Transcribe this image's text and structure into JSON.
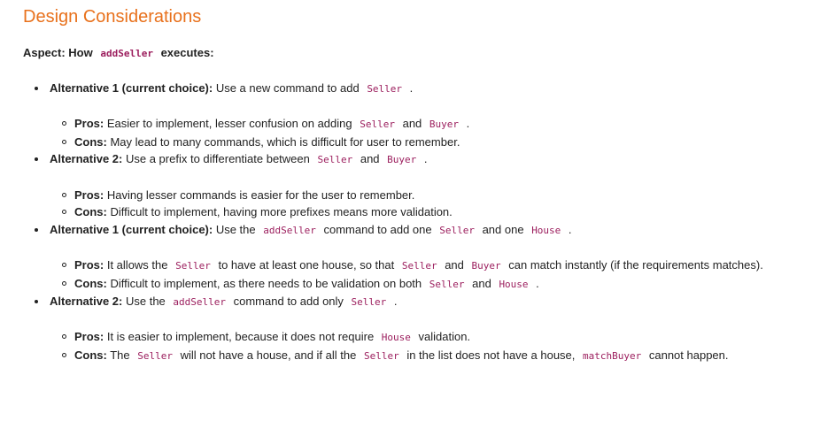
{
  "colors": {
    "heading": "#e8711c",
    "code": "#9c1f5e",
    "text": "#222222"
  },
  "title": "Design Considerations",
  "aspect": [
    {
      "b": "Aspect: How "
    },
    {
      "c": "addSeller"
    },
    {
      "b": " executes:"
    }
  ],
  "items": [
    {
      "text": [
        {
          "b": "Alternative 1 (current choice):"
        },
        {
          "t": " Use a new command to add "
        },
        {
          "c": "Seller"
        },
        {
          "t": " ."
        }
      ],
      "sub": [
        [
          {
            "b": "Pros:"
          },
          {
            "t": " Easier to implement, lesser confusion on adding "
          },
          {
            "c": "Seller"
          },
          {
            "t": " and "
          },
          {
            "c": "Buyer"
          },
          {
            "t": " ."
          }
        ],
        [
          {
            "b": "Cons:"
          },
          {
            "t": " May lead to many commands, which is difficult for user to remember."
          }
        ]
      ]
    },
    {
      "text": [
        {
          "b": "Alternative 2:"
        },
        {
          "t": " Use a prefix to differentiate between "
        },
        {
          "c": "Seller"
        },
        {
          "t": " and "
        },
        {
          "c": "Buyer"
        },
        {
          "t": " ."
        }
      ],
      "sub": [
        [
          {
            "b": "Pros:"
          },
          {
            "t": " Having lesser commands is easier for the user to remember."
          }
        ],
        [
          {
            "b": "Cons:"
          },
          {
            "t": " Difficult to implement, having more prefixes means more validation."
          }
        ]
      ]
    },
    {
      "text": [
        {
          "b": "Alternative 1 (current choice):"
        },
        {
          "t": " Use the "
        },
        {
          "c": "addSeller"
        },
        {
          "t": " command to add one "
        },
        {
          "c": "Seller"
        },
        {
          "t": " and one "
        },
        {
          "c": "House"
        },
        {
          "t": " ."
        }
      ],
      "sub": [
        [
          {
            "b": "Pros:"
          },
          {
            "t": " It allows the "
          },
          {
            "c": "Seller"
          },
          {
            "t": " to have at least one house, so that "
          },
          {
            "c": "Seller"
          },
          {
            "t": " and "
          },
          {
            "c": "Buyer"
          },
          {
            "t": " can match instantly (if the requirements matches)."
          }
        ],
        [
          {
            "b": "Cons:"
          },
          {
            "t": " Difficult to implement, as there needs to be validation on both "
          },
          {
            "c": "Seller"
          },
          {
            "t": " and "
          },
          {
            "c": "House"
          },
          {
            "t": " ."
          }
        ]
      ]
    },
    {
      "text": [
        {
          "b": "Alternative 2:"
        },
        {
          "t": " Use the "
        },
        {
          "c": "addSeller"
        },
        {
          "t": " command to add only "
        },
        {
          "c": "Seller"
        },
        {
          "t": " ."
        }
      ],
      "sub": [
        [
          {
            "b": "Pros:"
          },
          {
            "t": " It is easier to implement, because it does not require "
          },
          {
            "c": "House"
          },
          {
            "t": " validation."
          }
        ],
        [
          {
            "b": "Cons:"
          },
          {
            "t": " The "
          },
          {
            "c": "Seller"
          },
          {
            "t": " will not have a house, and if all the "
          },
          {
            "c": "Seller"
          },
          {
            "t": " in the list does not have a house, "
          },
          {
            "c": "matchBuyer"
          },
          {
            "t": " cannot happen."
          }
        ]
      ]
    }
  ]
}
